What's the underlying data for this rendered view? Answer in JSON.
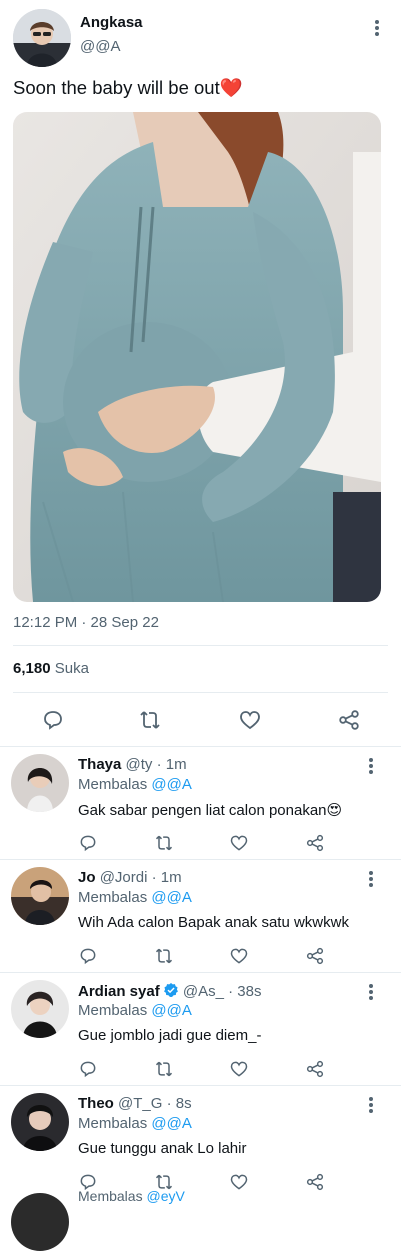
{
  "main_tweet": {
    "name": "Angkasa",
    "handle": "@@A",
    "text": "Soon the baby will be out",
    "emoji": "❤️",
    "time": "12:12 PM · 28 Sep 22",
    "likes_count": "6,180",
    "likes_label": "Suka"
  },
  "replies": [
    {
      "name": "Thaya",
      "handle": "@ty",
      "time": "1m",
      "replying_label": "Membalas",
      "replying_to": "@@A",
      "text": "Gak sabar pengen liat calon ponakan",
      "emoji": "😍"
    },
    {
      "name": "Jo",
      "handle": "@Jordi",
      "time": "1m",
      "replying_label": "Membalas",
      "replying_to": "@@A",
      "text": "Wih Ada calon Bapak anak satu wkwkwk",
      "emoji": ""
    },
    {
      "name": "Ardian syaf",
      "handle": "@As_",
      "time": "38s",
      "replying_label": "Membalas",
      "replying_to": "@@A",
      "text": "Gue jomblo jadi gue diem_-",
      "emoji": "",
      "verified": true
    },
    {
      "name": "Theo",
      "handle": "@T_G",
      "time": "8s",
      "replying_label": "Membalas",
      "replying_to": "@@A",
      "text": "Gue tunggu anak Lo lahir",
      "emoji": ""
    }
  ],
  "partial_reply": {
    "replying_label": "Membalas",
    "replying_to": "@eyV"
  },
  "colors": {
    "link": "#1d9bf0",
    "muted": "#536471",
    "border": "#e6ecf0",
    "heart": "#e0245e"
  }
}
